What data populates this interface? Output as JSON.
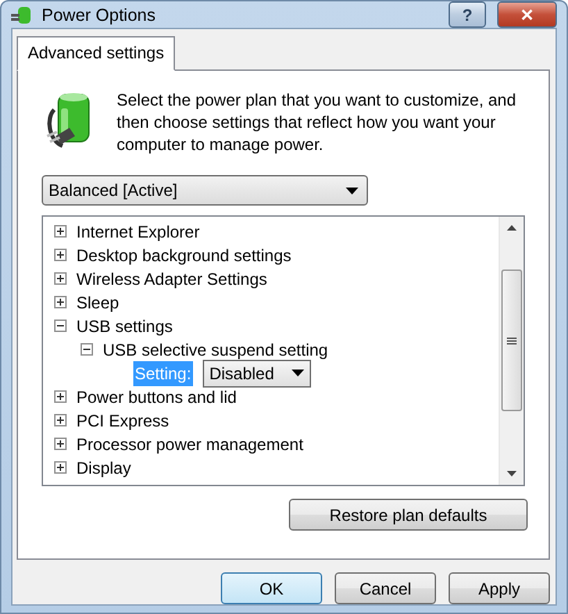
{
  "window": {
    "title": "Power Options",
    "buttons": [
      {
        "kind": "help",
        "label": "?"
      },
      {
        "kind": "close",
        "label": "✕"
      }
    ]
  },
  "tabs": [
    {
      "label": "Advanced settings",
      "selected": true
    }
  ],
  "intro": "Select the power plan that you want to customize, and then choose settings that reflect how you want your computer to manage power.",
  "plan_select": {
    "value": "Balanced [Active]"
  },
  "tree": [
    {
      "label": "Internet Explorer",
      "expanded": false
    },
    {
      "label": "Desktop background settings",
      "expanded": false
    },
    {
      "label": "Wireless Adapter Settings",
      "expanded": false
    },
    {
      "label": "Sleep",
      "expanded": false
    },
    {
      "label": "USB settings",
      "expanded": true,
      "children": [
        {
          "label": "USB selective suspend setting",
          "expanded": true,
          "setting": {
            "label": "Setting:",
            "value": "Disabled",
            "selected": true
          }
        }
      ]
    },
    {
      "label": "Power buttons and lid",
      "expanded": false
    },
    {
      "label": "PCI Express",
      "expanded": false
    },
    {
      "label": "Processor power management",
      "expanded": false
    },
    {
      "label": "Display",
      "expanded": false
    }
  ],
  "restore_button": "Restore plan defaults",
  "buttons": [
    {
      "label": "OK",
      "default": true
    },
    {
      "label": "Cancel",
      "default": false
    },
    {
      "label": "Apply",
      "default": false
    }
  ]
}
